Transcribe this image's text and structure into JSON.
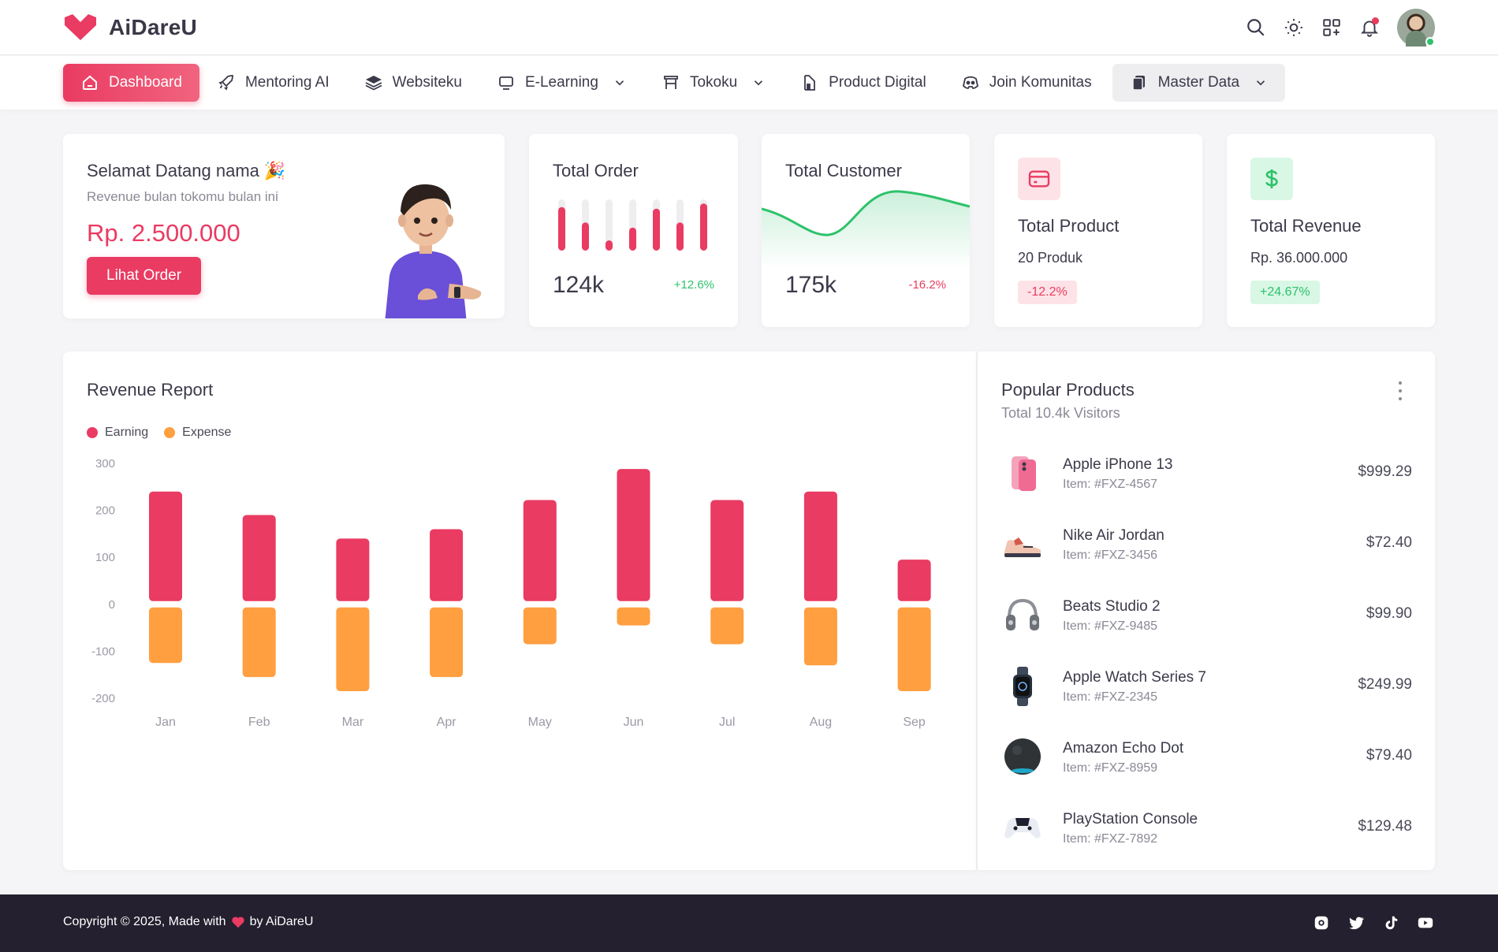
{
  "app": {
    "name": "AiDareU"
  },
  "topbar": {
    "icons": [
      "search-icon",
      "sun-icon",
      "grid-plus-icon",
      "bell-icon"
    ],
    "avatar_status": "online"
  },
  "nav": {
    "items": [
      {
        "label": "Dashboard",
        "icon": "home-icon",
        "active": true
      },
      {
        "label": "Mentoring AI",
        "icon": "rocket-icon"
      },
      {
        "label": "Websiteku",
        "icon": "layers-icon"
      },
      {
        "label": "E-Learning",
        "icon": "monitor-icon",
        "dropdown": true
      },
      {
        "label": "Tokoku",
        "icon": "store-icon",
        "dropdown": true
      },
      {
        "label": "Product Digital",
        "icon": "chart-file-icon"
      },
      {
        "label": "Join Komunitas",
        "icon": "discord-icon"
      },
      {
        "label": "Master Data",
        "icon": "copy-icon",
        "dropdown": true
      }
    ]
  },
  "welcome": {
    "title": "Selamat Datang nama",
    "emoji": "🎉",
    "subtitle": "Revenue bulan tokomu bulan ini",
    "amount": "Rp. 2.500.000",
    "button": "Lihat Order"
  },
  "stats": {
    "order": {
      "title": "Total Order",
      "value": "124k",
      "change": "+12.6%",
      "bar_levels": [
        0.85,
        0.55,
        0.2,
        0.45,
        0.82,
        0.55,
        0.92
      ]
    },
    "customer": {
      "title": "Total Customer",
      "value": "175k",
      "change": "-16.2%"
    },
    "product": {
      "title": "Total Product",
      "sub": "20 Produk",
      "change": "-12.2%",
      "icon": "credit-card-icon"
    },
    "revenue": {
      "title": "Total Revenue",
      "sub": "Rp. 36.000.000",
      "change": "+24.67%",
      "icon": "dollar-icon"
    }
  },
  "colors": {
    "accent": "#ea3b62",
    "orange": "#ff9f40",
    "green": "#2ec26b",
    "footer": "#24202f"
  },
  "report": {
    "title": "Revenue Report",
    "legend": [
      "Earning",
      "Expense"
    ]
  },
  "chart_data": {
    "type": "bar",
    "title": "Revenue Report",
    "categories": [
      "Jan",
      "Feb",
      "Mar",
      "Apr",
      "May",
      "Jun",
      "Jul",
      "Aug",
      "Sep"
    ],
    "series": [
      {
        "name": "Earning",
        "values": [
          240,
          190,
          140,
          160,
          222,
          288,
          222,
          240,
          95
        ]
      },
      {
        "name": "Expense",
        "values": [
          -125,
          -155,
          -185,
          -155,
          -85,
          -45,
          -85,
          -130,
          -185
        ]
      }
    ],
    "yticks": [
      300,
      200,
      100,
      0,
      -100,
      -200
    ],
    "ylim": [
      -200,
      300
    ],
    "legend": "top-left",
    "grid": false
  },
  "popular": {
    "title": "Popular Products",
    "subtitle": "Total 10.4k Visitors",
    "items": [
      {
        "name": "Apple iPhone 13",
        "item": "Item: #FXZ-4567",
        "price": "$999.29",
        "icon": "iphone-icon"
      },
      {
        "name": "Nike Air Jordan",
        "item": "Item: #FXZ-3456",
        "price": "$72.40",
        "icon": "sneaker-icon"
      },
      {
        "name": "Beats Studio 2",
        "item": "Item: #FXZ-9485",
        "price": "$99.90",
        "icon": "headphones-icon"
      },
      {
        "name": "Apple Watch Series 7",
        "item": "Item: #FXZ-2345",
        "price": "$249.99",
        "icon": "smartwatch-icon"
      },
      {
        "name": "Amazon Echo Dot",
        "item": "Item: #FXZ-8959",
        "price": "$79.40",
        "icon": "smart-speaker-icon"
      },
      {
        "name": "PlayStation Console",
        "item": "Item: #FXZ-7892",
        "price": "$129.48",
        "icon": "gamepad-icon"
      }
    ]
  },
  "footer": {
    "prefix": "Copyright © 2025, Made with",
    "suffix": "by AiDareU",
    "socials": [
      "instagram-icon",
      "twitter-icon",
      "tiktok-icon",
      "youtube-icon"
    ]
  }
}
